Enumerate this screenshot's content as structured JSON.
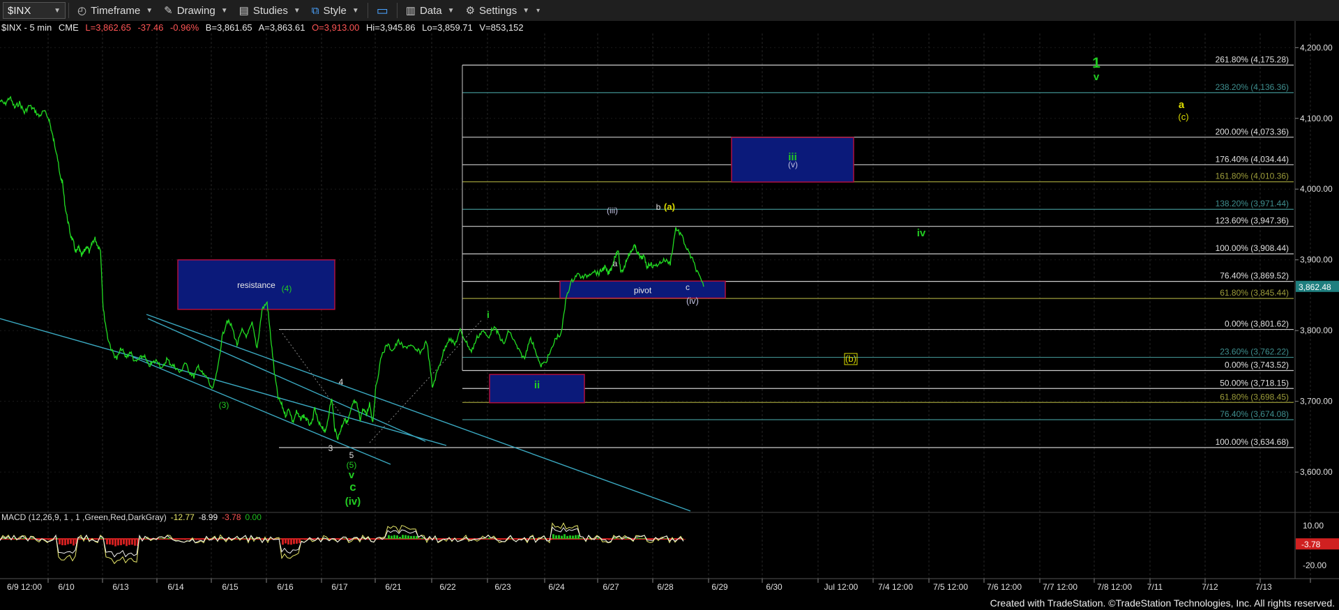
{
  "toolbar": {
    "symbol": "$INX",
    "buttons": [
      "Timeframe",
      "Drawing",
      "Studies",
      "Style",
      "Data",
      "Settings"
    ]
  },
  "header": {
    "instrument": "$INX - 5 min",
    "exchange": "CME",
    "last": "L=3,862.65",
    "change": "-37.46",
    "change_pct": "-0.96%",
    "bid": "B=3,861.65",
    "ask": "A=3,863.61",
    "open": "O=3,913.00",
    "high": "Hi=3,945.86",
    "low": "Lo=3,859.71",
    "volume": "V=853,152"
  },
  "colors": {
    "background": "#000000",
    "price_line": "#22dd22",
    "fib_line": "#4d7f7f",
    "trend_line": "#3aa8c0",
    "box_fill": "#0b1a7a",
    "box_border": "#b01040",
    "label_green": "#22cc22",
    "label_yellow": "#dddd00",
    "label_grey": "#b8b8d8",
    "last_price_tag": "#1f7f7f",
    "macd_tag": "#d02020",
    "up_change": "#dd3333"
  },
  "chart_data": {
    "type": "line",
    "title": "$INX - 5 min",
    "y_axis": {
      "ticks": [
        "4,200.00",
        "4,100.00",
        "4,000.00",
        "3,900.00",
        "3,800.00",
        "3,700.00",
        "3,600.00"
      ],
      "tick_values": [
        4200,
        4100,
        4000,
        3900,
        3800,
        3700,
        3600
      ],
      "ylim": [
        3543,
        4220
      ]
    },
    "x_axis": {
      "ticks": [
        "6/9 12:00",
        "6/10",
        "6/13",
        "6/14",
        "6/15",
        "6/16",
        "6/17",
        "6/21",
        "6/22",
        "6/23",
        "6/24",
        "6/27",
        "6/28",
        "6/29",
        "6/30",
        "Jul 12:00",
        "7/4 12:00",
        "7/5 12:00",
        "7/6 12:00",
        "7/7 12:00",
        "7/8 12:00",
        "7/11",
        "7/12",
        "7/13"
      ]
    },
    "last_price_tag": "3,862.48",
    "series": [
      {
        "values_by_session": [
          {
            "session": "6/9 12:00",
            "values": [
              4125,
              4120,
              4130,
              4115,
              4122,
              4108,
              4118,
              4112,
              4103,
              4110
            ]
          },
          {
            "session": "6/10",
            "values": [
              4100,
              4082,
              4065,
              4050,
              4020,
              4010,
              3975,
              3955,
              3935,
              3925,
              3910,
              3918,
              3905,
              3912,
              3920,
              3910,
              3925,
              3930,
              3920,
              3915
            ]
          },
          {
            "session": "6/13",
            "values": [
              3830,
              3790,
              3770,
              3760,
              3775,
              3762,
              3770,
              3755,
              3760,
              3765,
              3750,
              3755
            ]
          },
          {
            "session": "6/14",
            "values": [
              3758,
              3745,
              3760,
              3752,
              3748,
              3740,
              3755,
              3742,
              3735,
              3750,
              3738,
              3733
            ]
          },
          {
            "session": "6/15",
            "values": [
              3715,
              3740,
              3790,
              3815,
              3805,
              3780,
              3800,
              3792,
              3810,
              3775,
              3830
            ]
          },
          {
            "session": "6/16",
            "values": [
              3840,
              3790,
              3740,
              3705,
              3695,
              3680,
              3690,
              3670,
              3685,
              3675,
              3680,
              3672,
              3665,
              3690,
              3668
            ]
          },
          {
            "session": "6/17",
            "values": [
              3665,
              3655,
              3680,
              3705,
              3660,
              3648,
              3662,
              3675,
              3670,
              3685,
              3700,
              3695,
              3675,
              3690,
              3680,
              3698,
              3670
            ]
          },
          {
            "session": "6/21",
            "values": [
              3720,
              3765,
              3780,
              3772,
              3785,
              3775,
              3780,
              3772,
              3770,
              3785
            ]
          },
          {
            "session": "6/22",
            "values": [
              3720,
              3745,
              3770,
              3790,
              3780,
              3800,
              3785,
              3770,
              3790,
              3800
            ]
          },
          {
            "session": "6/23",
            "values": [
              3790,
              3805,
              3795,
              3780,
              3800,
              3785,
              3770,
              3760,
              3790,
              3775,
              3750
            ]
          },
          {
            "session": "6/24",
            "values": [
              3755,
              3770,
              3790,
              3795,
              3850,
              3870,
              3880,
              3875,
              3878,
              3885
            ]
          },
          {
            "session": "6/27",
            "values": [
              3880,
              3885,
              3890,
              3880,
              3888,
              3903,
              3915,
              3880,
              3890,
              3905,
              3910,
              3920,
              3912,
              3902,
              3905,
              3890,
              3895
            ]
          },
          {
            "session": "6/28",
            "values": [
              3890,
              3895,
              3900,
              3895,
              3945,
              3935,
              3915,
              3900,
              3880,
              3862
            ]
          }
        ]
      }
    ],
    "fib_levels": [
      {
        "label": "261.80% (4,175.28)",
        "value": 4175.28
      },
      {
        "label": "238.20% (4,136.36)",
        "value": 4136.36
      },
      {
        "label": "200.00% (4,073.36)",
        "value": 4073.36
      },
      {
        "label": "176.40% (4,034.44)",
        "value": 4034.44
      },
      {
        "label": "161.80% (4,010.36)",
        "value": 4010.36
      },
      {
        "label": "138.20% (3,971.44)",
        "value": 3971.44
      },
      {
        "label": "123.60% (3,947.36)",
        "value": 3947.36
      },
      {
        "label": "100.00% (3,908.44)",
        "value": 3908.44
      },
      {
        "label": "76.40% (3,869.52)",
        "value": 3869.52
      },
      {
        "label": "61.80% (3,845.44)",
        "value": 3845.44
      },
      {
        "label": "0.00% (3,801.62)",
        "value": 3801.62
      },
      {
        "label": "23.60% (3,762.22)",
        "value": 3762.22
      },
      {
        "label": "0.00% (3,743.52)",
        "value": 3743.52
      },
      {
        "label": "50.00% (3,718.15)",
        "value": 3718.15
      },
      {
        "label": "61.80% (3,698.45)",
        "value": 3698.45
      },
      {
        "label": "76.40% (3,674.08)",
        "value": 3674.08
      },
      {
        "label": "100.00% (3,634.68)",
        "value": 3634.68
      }
    ],
    "boxes": [
      {
        "text": "resistance",
        "from": "6/14",
        "to": "6/16",
        "ylim": [
          3830,
          3900
        ]
      },
      {
        "text": "pivot",
        "from": "6/24",
        "to": "6/28",
        "ylim": [
          3846,
          3870
        ]
      },
      {
        "text": "ii",
        "from": "6/23",
        "to": "6/24",
        "ylim": [
          3698,
          3738
        ]
      },
      {
        "text": "iii",
        "from": "6/29",
        "to": "6/30",
        "ylim": [
          4010,
          4073
        ]
      }
    ],
    "annotations": [
      "(4)",
      "(3)",
      "4",
      "3",
      "5",
      "(5)",
      "v",
      "c",
      "(iv)",
      "i",
      "a",
      "(iii)",
      "b",
      "(a)",
      "c",
      "(iv)",
      "(v)",
      "iv",
      "1",
      "v",
      "a",
      "(c)",
      "(b)"
    ],
    "macd": {
      "label": "MACD (12,26,9, 1 , 1 ,Green,Red,DarkGray)",
      "macd": "-12.77",
      "signal": "-8.99",
      "diff": "-3.78",
      "zero": "0.00",
      "ticks": [
        "10.00",
        "-20.00"
      ],
      "tick_values": [
        10,
        -20
      ],
      "tag": "-3.78",
      "ylim": [
        -30,
        20
      ]
    }
  },
  "footer": {
    "credit": "Created with TradeStation. ©TradeStation Technologies, Inc. All rights reserved."
  }
}
